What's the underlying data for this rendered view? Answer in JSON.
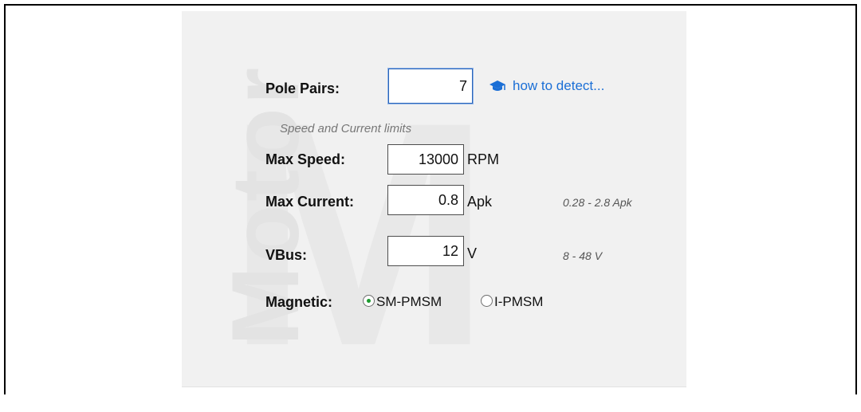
{
  "panel": {
    "watermark_text": "Motor",
    "watermark_letter": "M"
  },
  "pole_pairs": {
    "label": "Pole Pairs:",
    "value": "7",
    "help_link": "how to detect...",
    "help_icon": "graduation-cap-icon"
  },
  "limits": {
    "subheading": "Speed and Current limits",
    "max_speed": {
      "label": "Max Speed:",
      "value": "13000",
      "unit": "RPM"
    },
    "max_current": {
      "label": "Max Current:",
      "value": "0.8",
      "unit": "Apk",
      "range": "0.28 - 2.8 Apk"
    }
  },
  "vbus": {
    "label": "VBus:",
    "value": "12",
    "unit": "V",
    "range": "8 - 48 V"
  },
  "magnetic": {
    "label": "Magnetic:",
    "options": [
      {
        "label": "SM-PMSM",
        "selected": true
      },
      {
        "label": "I-PMSM",
        "selected": false
      }
    ]
  },
  "colors": {
    "link": "#1b6fd6",
    "radio_selected": "#1b9a2e",
    "focus_border": "#2a64b8"
  }
}
